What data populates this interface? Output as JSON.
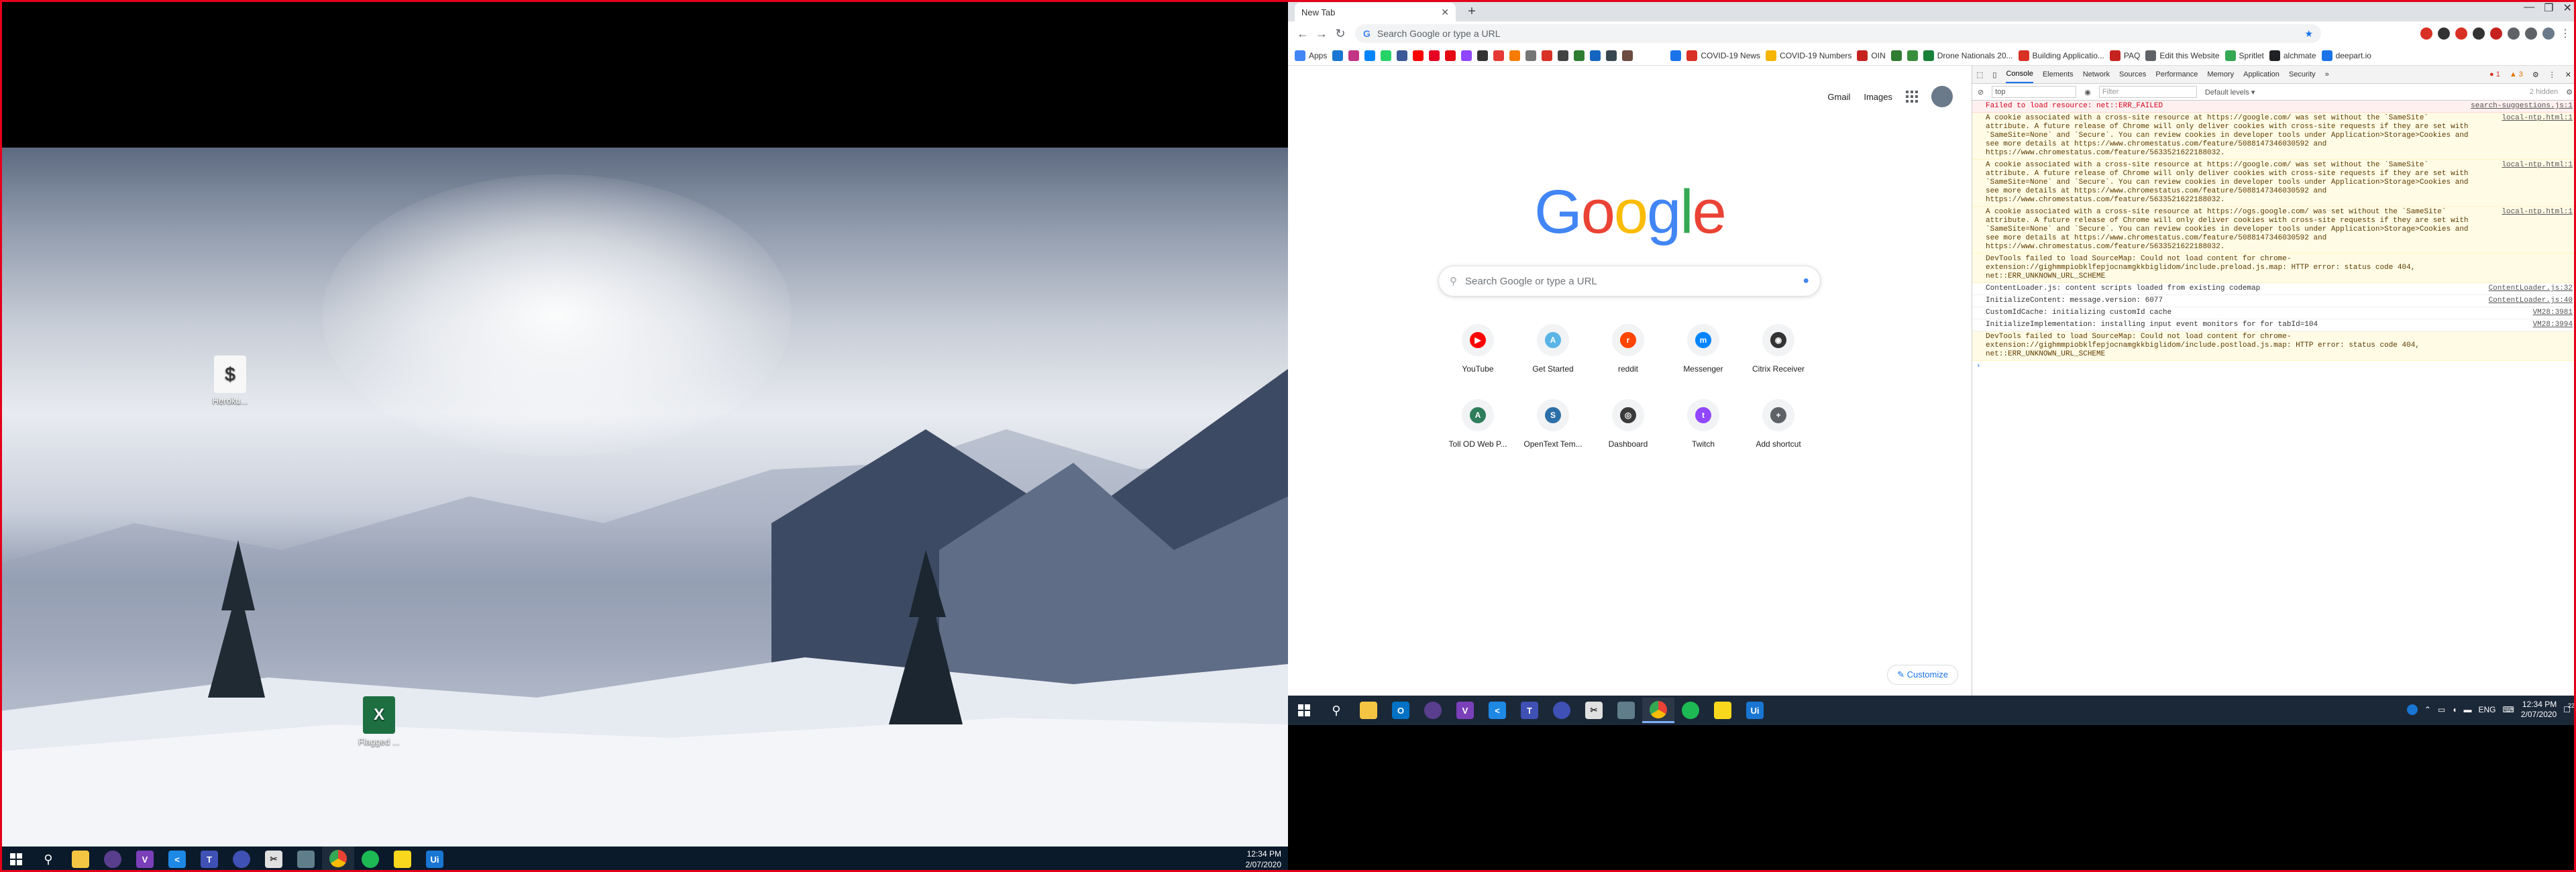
{
  "left_desktop": {
    "icons": [
      {
        "label": "Heroku..."
      },
      {
        "label": "Flagged ..."
      }
    ],
    "taskbar_apps": [
      "start",
      "search",
      "outlook",
      "visual-studio",
      "teams",
      "file-explorer",
      "obs",
      "hub",
      "chrome",
      "spotify",
      "sticky-notes",
      "uipath"
    ],
    "clock": {
      "time": "12:34 PM",
      "date": "2/07/2020"
    }
  },
  "browser": {
    "tab_title": "New Tab",
    "omnibox_placeholder": "Search Google or type a URL",
    "bookmarks": [
      {
        "label": "Apps",
        "color": "#4285f4"
      },
      {
        "label": "COVID-19 News",
        "color": "#d93025"
      },
      {
        "label": "COVID-19 Numbers",
        "color": "#f4b400"
      },
      {
        "label": "OIN",
        "color": "#c5221f"
      },
      {
        "label": "Drone Nationals 20...",
        "color": "#188038"
      },
      {
        "label": "Building Applicatio...",
        "color": "#d93025"
      },
      {
        "label": "PAQ",
        "color": "#c5221f"
      },
      {
        "label": "Edit this Website",
        "color": "#5f6368"
      },
      {
        "label": "Spritlet",
        "color": "#34a853"
      },
      {
        "label": "alchmate",
        "color": "#202124"
      },
      {
        "label": "deepart.io",
        "color": "#1a73e8"
      }
    ],
    "ntp": {
      "gmail": "Gmail",
      "images": "Images",
      "logo": "Google",
      "search_placeholder": "Search Google or type a URL",
      "shortcuts": [
        {
          "label": "YouTube",
          "color": "#ff0000",
          "glyph": "▶"
        },
        {
          "label": "Get Started",
          "color": "#5ab4e5",
          "glyph": "A"
        },
        {
          "label": "reddit",
          "color": "#ff4500",
          "glyph": "r"
        },
        {
          "label": "Messenger",
          "color": "#0084ff",
          "glyph": "m"
        },
        {
          "label": "Citrix Receiver",
          "color": "#333333",
          "glyph": "◉"
        },
        {
          "label": "Toll OD Web P...",
          "color": "#2e7d5b",
          "glyph": "A"
        },
        {
          "label": "OpenText Tem...",
          "color": "#2d6fa8",
          "glyph": "S"
        },
        {
          "label": "Dashboard",
          "color": "#3a3a3a",
          "glyph": "◎"
        },
        {
          "label": "Twitch",
          "color": "#9146ff",
          "glyph": "t"
        },
        {
          "label": "Add shortcut",
          "color": "#5f6368",
          "glyph": "+"
        }
      ],
      "customize": "Customize"
    }
  },
  "devtools": {
    "tabs": [
      "Console",
      "Elements",
      "Network",
      "Sources",
      "Performance",
      "Memory",
      "Application",
      "Security"
    ],
    "active_tab": "Console",
    "context": "top",
    "filter_placeholder": "Filter",
    "levels": "Default levels ▾",
    "hidden": "2 hidden",
    "errors": "1",
    "warnings": "3",
    "messages": [
      {
        "type": "err",
        "text": "Failed to load resource: net::ERR_FAILED",
        "src": "search-suggestions.js:1"
      },
      {
        "type": "warn",
        "text": "A cookie associated with a cross-site resource at https://google.com/ was set without the `SameSite` attribute. A future release of Chrome will only deliver cookies with cross-site requests if they are set with `SameSite=None` and `Secure`. You can review cookies in developer tools under Application>Storage>Cookies and see more details at https://www.chromestatus.com/feature/5088147346030592 and https://www.chromestatus.com/feature/5633521622188032.",
        "src": "local-ntp.html:1"
      },
      {
        "type": "warn",
        "text": "A cookie associated with a cross-site resource at https://google.com/ was set without the `SameSite` attribute. A future release of Chrome will only deliver cookies with cross-site requests if they are set with `SameSite=None` and `Secure`. You can review cookies in developer tools under Application>Storage>Cookies and see more details at https://www.chromestatus.com/feature/5088147346030592 and https://www.chromestatus.com/feature/5633521622188032.",
        "src": "local-ntp.html:1"
      },
      {
        "type": "warn",
        "text": "A cookie associated with a cross-site resource at https://ogs.google.com/ was set without the `SameSite` attribute. A future release of Chrome will only deliver cookies with cross-site requests if they are set with `SameSite=None` and `Secure`. You can review cookies in developer tools under Application>Storage>Cookies and see more details at https://www.chromestatus.com/feature/5088147346030592 and https://www.chromestatus.com/feature/5633521622188032.",
        "src": "local-ntp.html:1"
      },
      {
        "type": "warn",
        "text": "DevTools failed to load SourceMap: Could not load content for chrome-extension://gighmmpiobklfepjocnamgkkbiglidom/include.preload.js.map: HTTP error: status code 404, net::ERR_UNKNOWN_URL_SCHEME",
        "src": ""
      },
      {
        "type": "info",
        "text": "ContentLoader.js: content scripts loaded from existing codemap",
        "src": "ContentLoader.js:32"
      },
      {
        "type": "info",
        "text": "InitializeContent: message.version: 6077",
        "src": "ContentLoader.js:40"
      },
      {
        "type": "info",
        "text": "CustomIdCache: initializing customId cache",
        "src": "VM28:3981"
      },
      {
        "type": "info",
        "text": "InitializeImplementation: installing input event monitors for for tabId=104",
        "src": "VM28:3994"
      },
      {
        "type": "warn",
        "text": "DevTools failed to load SourceMap: Could not load content for chrome-extension://gighmmpiobklfepjocnamgkkbiglidom/include.postload.js.map: HTTP error: status code 404, net::ERR_UNKNOWN_URL_SCHEME",
        "src": ""
      }
    ]
  },
  "right_taskbar": {
    "apps": [
      "start",
      "search",
      "file-explorer",
      "outlook",
      "obs",
      "visual-studio",
      "vscode",
      "teams",
      "hub",
      "snip",
      "capture",
      "chrome",
      "spotify",
      "sticky-notes",
      "uipath"
    ],
    "lang": "ENG",
    "clock": {
      "time": "12:34 PM",
      "date": "2/07/2020"
    },
    "notif_count": "22"
  }
}
